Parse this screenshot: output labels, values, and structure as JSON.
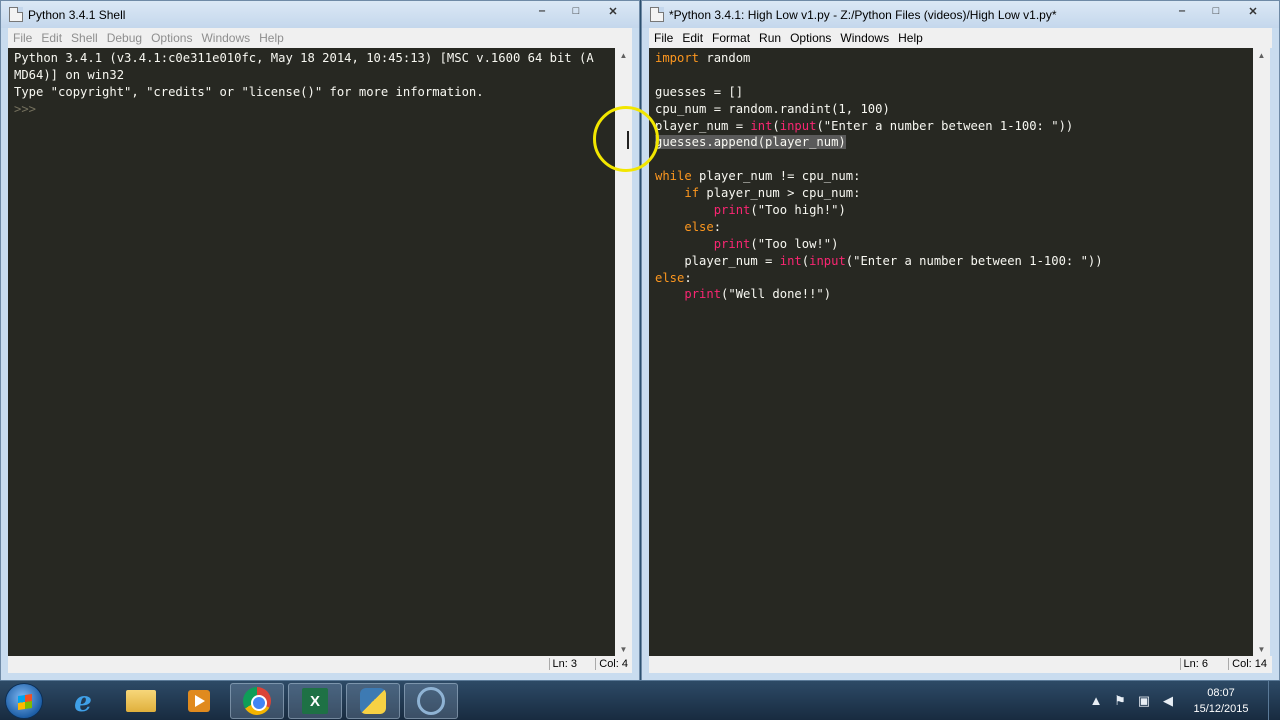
{
  "shell": {
    "title": "Python 3.4.1 Shell",
    "menu": [
      "File",
      "Edit",
      "Shell",
      "Debug",
      "Options",
      "Windows",
      "Help"
    ],
    "lines": [
      [
        {
          "t": "Python 3.4.1 (v3.4.1:c0e311e010fc, May 18 2014, 10:45:13) [MSC v.1600 64 bit (A",
          "c": "#f8f8f2"
        }
      ],
      [
        {
          "t": "MD64)] on win32",
          "c": "#f8f8f2"
        }
      ],
      [
        {
          "t": "Type \"copyright\", \"credits\" or \"license()\" for more information.",
          "c": "#f8f8f2"
        }
      ],
      [
        {
          "t": ">>> ",
          "c": "#75715e"
        }
      ]
    ],
    "status_ln": "Ln: 3",
    "status_col": "Col: 4"
  },
  "editor": {
    "title": "*Python 3.4.1: High Low v1.py - Z:/Python Files (videos)/High Low v1.py*",
    "menu": [
      "File",
      "Edit",
      "Format",
      "Run",
      "Options",
      "Windows",
      "Help"
    ],
    "lines": [
      [
        {
          "t": "import",
          "c": "#fd971f"
        },
        {
          "t": " random",
          "c": "#f8f8f2"
        }
      ],
      [],
      [
        {
          "t": "guesses = []",
          "c": "#f8f8f2"
        }
      ],
      [
        {
          "t": "cpu_num = random.randint(1, 100)",
          "c": "#f8f8f2"
        }
      ],
      [
        {
          "t": "player_num = ",
          "c": "#f8f8f2"
        },
        {
          "t": "int",
          "c": "#f92672"
        },
        {
          "t": "(",
          "c": "#f8f8f2"
        },
        {
          "t": "input",
          "c": "#f92672"
        },
        {
          "t": "(\"Enter a number between 1-100: \"))",
          "c": "#f8f8f2"
        }
      ],
      [
        {
          "t": "guesses.append(player_num)",
          "c": "#f8f8f2",
          "hl": true
        }
      ],
      [],
      [
        {
          "t": "while",
          "c": "#fd971f"
        },
        {
          "t": " player_num != cpu_num:",
          "c": "#f8f8f2"
        }
      ],
      [
        {
          "t": "    ",
          "c": "#f8f8f2"
        },
        {
          "t": "if",
          "c": "#fd971f"
        },
        {
          "t": " player_num > cpu_num:",
          "c": "#f8f8f2"
        }
      ],
      [
        {
          "t": "        ",
          "c": "#f8f8f2"
        },
        {
          "t": "print",
          "c": "#f92672"
        },
        {
          "t": "(\"Too high!\")",
          "c": "#f8f8f2"
        }
      ],
      [
        {
          "t": "    ",
          "c": "#f8f8f2"
        },
        {
          "t": "else",
          "c": "#fd971f"
        },
        {
          "t": ":",
          "c": "#f8f8f2"
        }
      ],
      [
        {
          "t": "        ",
          "c": "#f8f8f2"
        },
        {
          "t": "print",
          "c": "#f92672"
        },
        {
          "t": "(\"Too low!\")",
          "c": "#f8f8f2"
        }
      ],
      [
        {
          "t": "    player_num = ",
          "c": "#f8f8f2"
        },
        {
          "t": "int",
          "c": "#f92672"
        },
        {
          "t": "(",
          "c": "#f8f8f2"
        },
        {
          "t": "input",
          "c": "#f92672"
        },
        {
          "t": "(\"Enter a number between 1-100: \"))",
          "c": "#f8f8f2"
        }
      ],
      [
        {
          "t": "else",
          "c": "#fd971f"
        },
        {
          "t": ":",
          "c": "#f8f8f2"
        }
      ],
      [
        {
          "t": "    ",
          "c": "#f8f8f2"
        },
        {
          "t": "print",
          "c": "#f92672"
        },
        {
          "t": "(\"Well done!!\")",
          "c": "#f8f8f2"
        }
      ]
    ],
    "status_ln": "Ln: 6",
    "status_col": "Col: 14"
  },
  "window_controls": {
    "minimize": "‒",
    "maximize": "□",
    "close": "✕"
  },
  "taskbar": {
    "apps": [
      "internet-explorer",
      "file-explorer",
      "media-player",
      "chrome",
      "excel",
      "python-idle",
      "unknown-app"
    ],
    "clock_time": "08:07",
    "clock_date": "15/12/2015"
  },
  "colors": {
    "editor_bg": "#272822",
    "keyword": "#fd971f",
    "builtin": "#f92672",
    "prompt": "#75715e",
    "selection": "#5a5a5a",
    "cursor_highlight": "#f2e600"
  }
}
